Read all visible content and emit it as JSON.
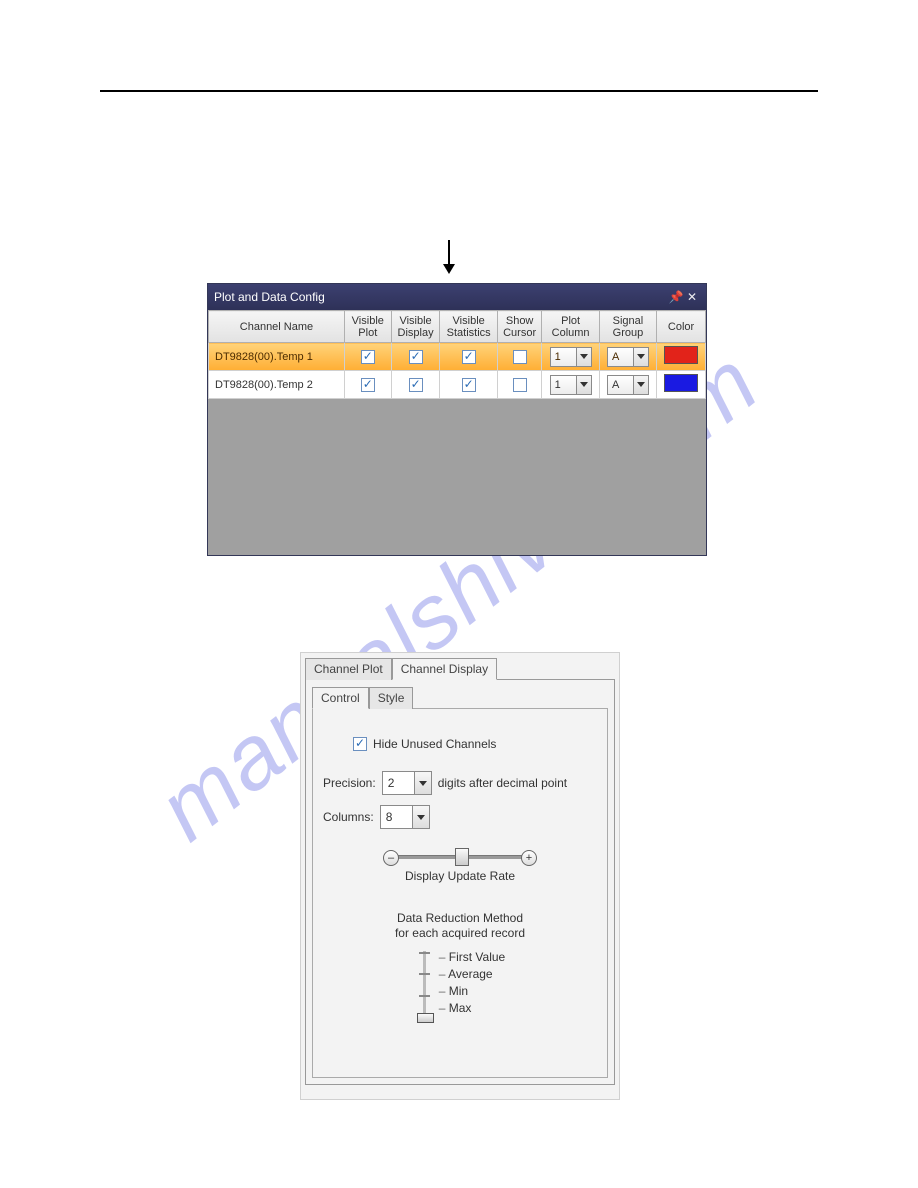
{
  "watermark": "manualshive.com",
  "plotDataConfig": {
    "title": "Plot and Data Config",
    "columns": {
      "channelName": "Channel Name",
      "visiblePlot": "Visible\nPlot",
      "visibleDisplay": "Visible\nDisplay",
      "visibleStatistics": "Visible\nStatistics",
      "showCursor": "Show\nCursor",
      "plotColumn": "Plot\nColumn",
      "signalGroup": "Signal\nGroup",
      "color": "Color"
    },
    "rows": [
      {
        "name": "DT9828(00).Temp 1",
        "visiblePlot": true,
        "visibleDisplay": true,
        "visibleStatistics": true,
        "showCursor": false,
        "plotColumn": "1",
        "signalGroup": "A",
        "colorClass": "swatch-red",
        "selected": true
      },
      {
        "name": "DT9828(00).Temp 2",
        "visiblePlot": true,
        "visibleDisplay": true,
        "visibleStatistics": true,
        "showCursor": false,
        "plotColumn": "1",
        "signalGroup": "A",
        "colorClass": "swatch-blue",
        "selected": false
      }
    ]
  },
  "channelDisplay": {
    "outerTabs": {
      "channelPlot": "Channel Plot",
      "channelDisplay": "Channel Display"
    },
    "innerTabs": {
      "control": "Control",
      "style": "Style"
    },
    "hideUnusedLabel": "Hide Unused Channels",
    "hideUnusedChecked": true,
    "precisionLabel": "Precision:",
    "precisionValue": "2",
    "precisionSuffix": "digits after decimal point",
    "columnsLabel": "Columns:",
    "columnsValue": "8",
    "sliderLabel": "Display Update Rate",
    "minusSymbol": "–",
    "plusSymbol": "+",
    "drmLine1": "Data Reduction Method",
    "drmLine2": "for each acquired record",
    "drmOptions": [
      "First Value",
      "Average",
      "Min",
      "Max"
    ],
    "drmSelectedIndex": 3
  }
}
